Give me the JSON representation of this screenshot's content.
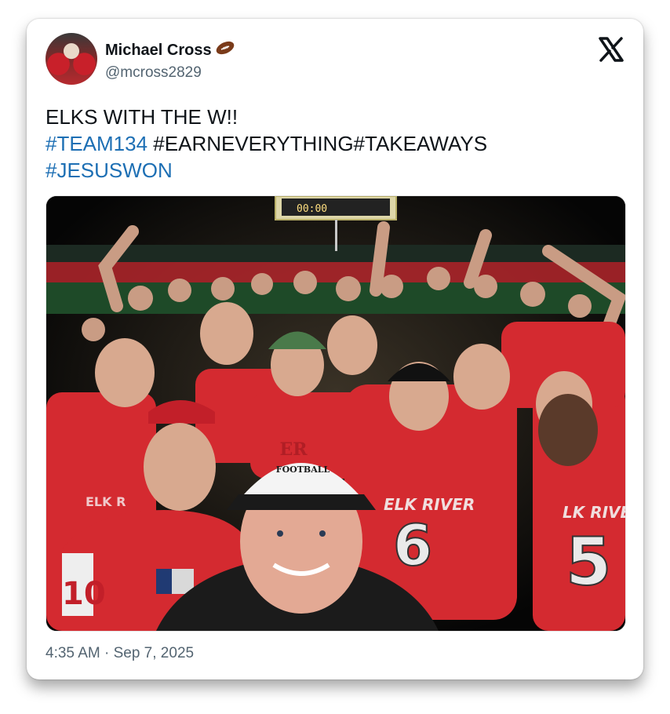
{
  "post": {
    "author_name": "Michael Cross",
    "handle": "@mcross2829",
    "text_line1": "ELKS WITH THE W!!",
    "hashtag1": "#TEAM134",
    "hashtag_rest": " #EARNEVERYTHING#TAKEAWAYS",
    "hashtag3": "#JESUSWON",
    "timestamp": "4:35 AM · Sep 7, 2025"
  },
  "photo": {
    "scoreboard": "00:00",
    "hat_line1": "ER",
    "hat_line2": "FOOTBALL",
    "jersey_left": "ELK RIVER",
    "jersey_right": "LK RIVER",
    "num_6": "6",
    "num_5": "5",
    "num_10": "10"
  },
  "icons": {
    "football": "football-emoji-icon",
    "logo": "x-logo-icon"
  },
  "colors": {
    "hashtag": "#1d6fb4",
    "jersey_red": "#d42a30"
  }
}
